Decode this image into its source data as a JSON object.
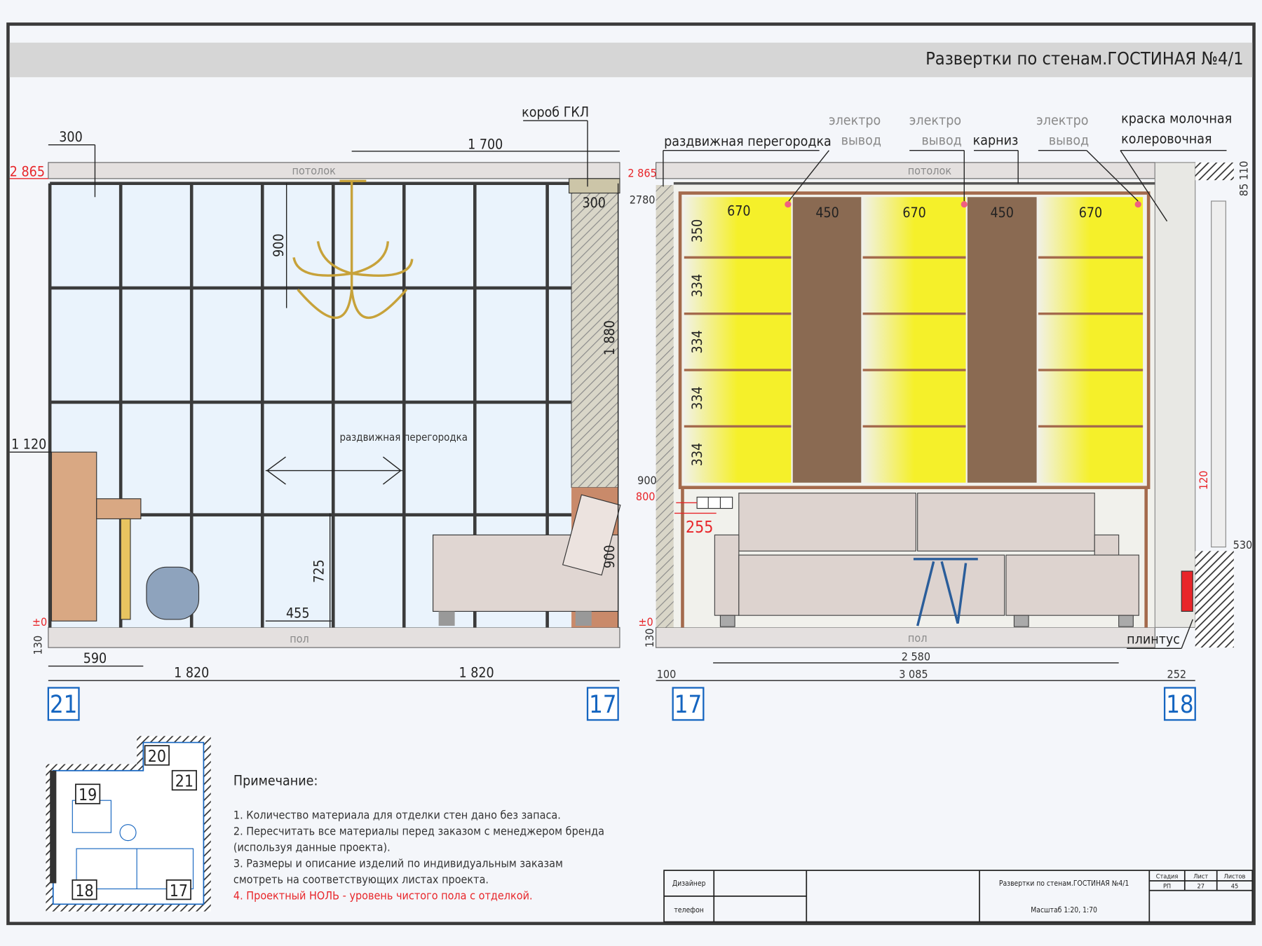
{
  "header": {
    "title": "Развертки по стенам.ГОСТИНАЯ №4/1"
  },
  "left_elevation": {
    "labels": {
      "ceiling": "потолок",
      "floor": "пол",
      "gkl_box": "короб ГКЛ",
      "sliding_partition": "раздвижная перегородка"
    },
    "dims": {
      "top_level": "2 865",
      "zero": "±0",
      "d300_top": "300",
      "d1700": "1 700",
      "d300_box": "300",
      "d900_chand": "900",
      "d1880": "1 880",
      "d1120": "1 120",
      "d725": "725",
      "d455": "455",
      "d900_sofa": "900",
      "d130": "130",
      "d590": "590",
      "d1820a": "1 820",
      "d1820b": "1 820"
    },
    "markers": {
      "left": "21",
      "right": "17"
    }
  },
  "right_elevation": {
    "labels": {
      "ceiling": "потолок",
      "floor": "пол",
      "sliding_partition": "раздвижная перегородка",
      "electro1": [
        "электро",
        "вывод"
      ],
      "electro2": [
        "электро",
        "вывод"
      ],
      "electro3": [
        "электро",
        "вывод"
      ],
      "cornice": "карниз",
      "paint": [
        "краска молочная",
        "колеровочная"
      ],
      "plinth": "плинтус"
    },
    "dims": {
      "top_level": "2 865",
      "d2780": "2780",
      "zero": "±0",
      "d130": "130",
      "cols": [
        "670",
        "450",
        "670",
        "450",
        "670"
      ],
      "rows": [
        "350",
        "334",
        "334",
        "334",
        "334"
      ],
      "d900": "900",
      "d800": "800",
      "d255": "255",
      "d110": "110",
      "d85": "85",
      "d120": "120",
      "d530": "530",
      "d100": "100",
      "d2580": "2 580",
      "d3085": "3 085",
      "d252": "252"
    },
    "markers": {
      "left": "17",
      "right": "18"
    }
  },
  "plan": {
    "markers": [
      "20",
      "21",
      "19",
      "18",
      "17"
    ]
  },
  "notes": {
    "title": "Примечание:",
    "items": [
      "1. Количество материала для отделки стен дано без запаса.",
      "2. Пересчитать все материалы перед заказом с менеджером бренда",
      "(используя данные проекта).",
      "3. Размеры и описание изделий по индивидуальным заказам",
      "смотреть на соответствующих листах проекта."
    ],
    "highlight": "4. Проектный НОЛЬ - уровень чистого пола с отделкой."
  },
  "title_block": {
    "designer": "Дизайнер",
    "phone": "телефон",
    "sheet_name": "Развертки по стенам.ГОСТИНАЯ №4/1",
    "scale": "Масштаб 1:20, 1:70",
    "stage_label": "Стадия",
    "sheet_label": "Лист",
    "sheets_label": "Листов",
    "stage": "РП",
    "sheet": "27",
    "sheets": "45"
  },
  "colors": {
    "yellow": "#f5f02a",
    "wood": "#8a6a52",
    "glass": "#eaf3fc",
    "accent_red": "#e8262a",
    "marker_blue": "#1565c0"
  }
}
